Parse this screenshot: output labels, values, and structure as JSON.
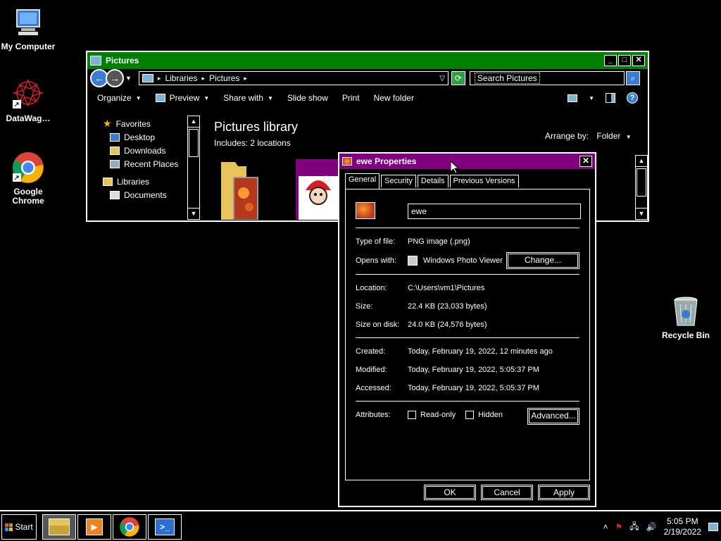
{
  "desktop": {
    "icons": [
      {
        "label": "My Computer"
      },
      {
        "label": "DataWag…"
      },
      {
        "label": "Google\nChrome"
      },
      {
        "label": "Recycle Bin"
      }
    ]
  },
  "explorer": {
    "title": "Pictures",
    "breadcrumb": [
      "Libraries",
      "Pictures"
    ],
    "search_placeholder": "Search Pictures",
    "toolbar": {
      "organize": "Organize",
      "preview": "Preview",
      "share_with": "Share with",
      "slide_show": "Slide show",
      "print": "Print",
      "new_folder": "New folder"
    },
    "nav": {
      "favorites": "Favorites",
      "desktop": "Desktop",
      "downloads": "Downloads",
      "recent_places": "Recent Places",
      "libraries": "Libraries",
      "documents": "Documents"
    },
    "library_title": "Pictures library",
    "library_sub": "Includes:  2 locations",
    "arrange_by_label": "Arrange by:",
    "arrange_by_value": "Folder"
  },
  "props": {
    "title": "ewe Properties",
    "tabs": [
      "General",
      "Security",
      "Details",
      "Previous Versions"
    ],
    "file_name": "ewe",
    "type_of_file_label": "Type of file:",
    "type_of_file": "PNG image (.png)",
    "opens_with_label": "Opens with:",
    "opens_with": "Windows Photo Viewer",
    "change_btn": "Change...",
    "location_label": "Location:",
    "location": "C:\\Users\\vm1\\Pictures",
    "size_label": "Size:",
    "size": "22.4 KB (23,033 bytes)",
    "size_on_disk_label": "Size on disk:",
    "size_on_disk": "24.0 KB (24,576 bytes)",
    "created_label": "Created:",
    "created": "Today, February 19, 2022, 12 minutes ago",
    "modified_label": "Modified:",
    "modified": "Today, February 19, 2022, 5:05:37 PM",
    "accessed_label": "Accessed:",
    "accessed": "Today, February 19, 2022, 5:05:37 PM",
    "attributes_label": "Attributes:",
    "readonly": "Read-only",
    "hidden": "Hidden",
    "advanced_btn": "Advanced...",
    "ok": "OK",
    "cancel": "Cancel",
    "apply": "Apply"
  },
  "taskbar": {
    "start": "Start",
    "time": "5:05 PM",
    "date": "2/19/2022"
  }
}
